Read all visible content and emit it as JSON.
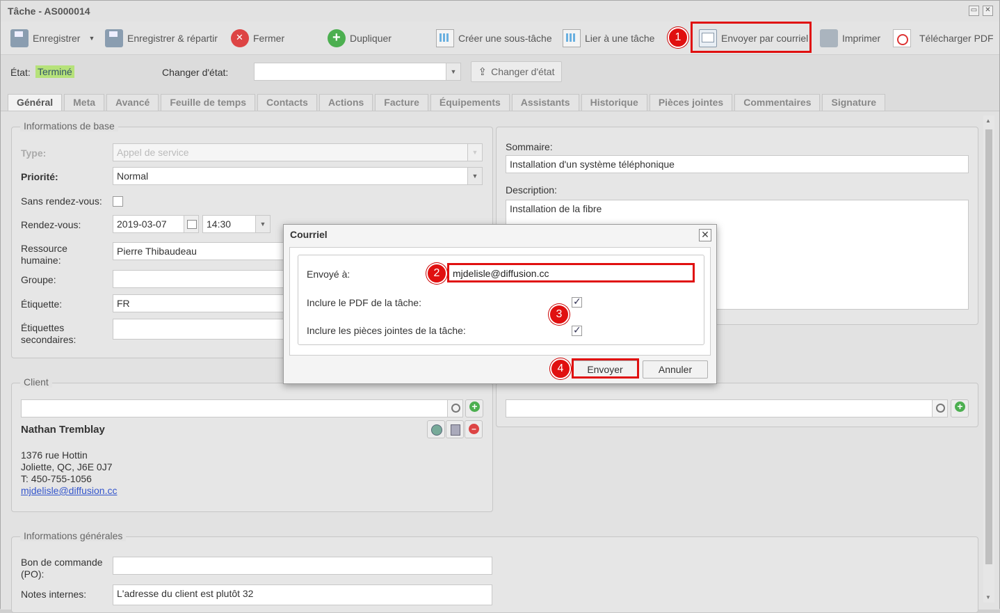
{
  "window": {
    "title": "Tâche - AS000014"
  },
  "toolbar": {
    "save": "Enregistrer",
    "save_dispatch": "Enregistrer & répartir",
    "close": "Fermer",
    "duplicate": "Dupliquer",
    "create_subtask": "Créer une sous-tâche",
    "link_task": "Lier à une tâche",
    "send_email": "Envoyer par courriel",
    "print": "Imprimer",
    "download_pdf": "Télécharger PDF"
  },
  "state": {
    "label": "État:",
    "value": "Terminé",
    "change_label": "Changer d'état:",
    "change_value": "",
    "change_button": "Changer d'état"
  },
  "tabs": [
    "Général",
    "Meta",
    "Avancé",
    "Feuille de temps",
    "Contacts",
    "Actions",
    "Facture",
    "Équipements",
    "Assistants",
    "Historique",
    "Pièces jointes",
    "Commentaires",
    "Signature"
  ],
  "basic_info": {
    "legend": "Informations de base",
    "type_label": "Type:",
    "type_value": "Appel de service",
    "priority_label": "Priorité:",
    "priority_value": "Normal",
    "no_appt_label": "Sans rendez-vous:",
    "appt_label": "Rendez-vous:",
    "appt_date": "2019-03-07",
    "appt_time": "14:30",
    "resource_label_1": "Ressource",
    "resource_label_2": "humaine:",
    "resource_value": "Pierre Thibaudeau",
    "group_label": "Groupe:",
    "tag_label": "Étiquette:",
    "tag_value": "FR",
    "sec_tags_label_1": "Étiquettes",
    "sec_tags_label_2": "secondaires:"
  },
  "summary": {
    "summary_label": "Sommaire:",
    "summary_value": "Installation d'un système téléphonique",
    "description_label": "Description:",
    "description_value": "Installation de la fibre"
  },
  "client": {
    "legend": "Client",
    "name": "Nathan Tremblay",
    "address_1": "1376 rue Hottin",
    "address_2": "Joliette, QC, J6E 0J7",
    "phone": "T: 450-755-1056",
    "email": "mjdelisle@diffusion.cc"
  },
  "general_info": {
    "legend": "Informations générales",
    "po_label_1": "Bon de commande",
    "po_label_2": "(PO):",
    "notes_label": "Notes internes:",
    "notes_value": "L'adresse du client est plutôt 32"
  },
  "dialog": {
    "title": "Courriel",
    "sent_to_label": "Envoyé à:",
    "sent_to_value": "mjdelisle@diffusion.cc",
    "include_pdf_label": "Inclure le PDF de la tâche:",
    "include_attachments_label": "Inclure les pièces jointes de la tâche:",
    "send_button": "Envoyer",
    "cancel_button": "Annuler"
  },
  "markers": [
    "1",
    "2",
    "3",
    "4"
  ],
  "colors": {
    "highlight": "#e01010",
    "state_badge": "#b6e27a"
  }
}
